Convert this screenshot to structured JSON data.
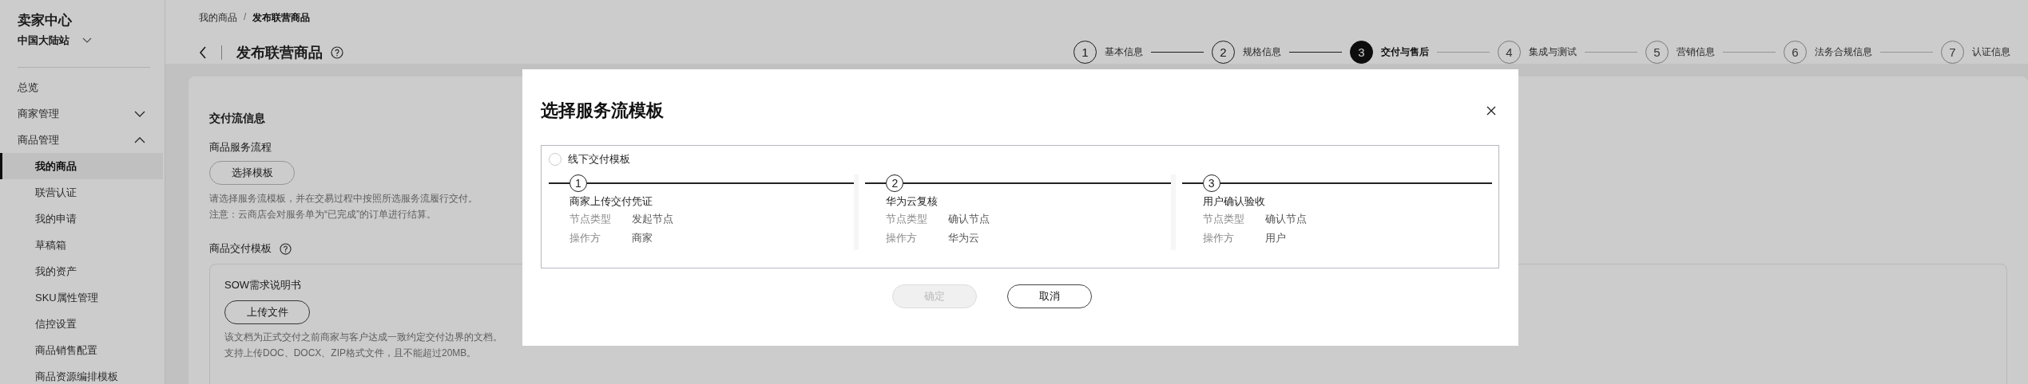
{
  "sidebar": {
    "title": "卖家中心",
    "site": "中国大陆站",
    "items": [
      {
        "label": "总览",
        "selected": false
      },
      {
        "label": "商家管理",
        "selected": false,
        "expanded": false
      },
      {
        "label": "商品管理",
        "selected": false,
        "expanded": true,
        "children": [
          {
            "label": "我的商品",
            "selected": true
          },
          {
            "label": "联营认证",
            "selected": false
          },
          {
            "label": "我的申请",
            "selected": false
          },
          {
            "label": "草稿箱",
            "selected": false
          },
          {
            "label": "我的资产",
            "selected": false
          },
          {
            "label": "SKU属性管理",
            "selected": false
          },
          {
            "label": "信控设置",
            "selected": false
          },
          {
            "label": "商品销售配置",
            "selected": false
          },
          {
            "label": "商品资源编排模板",
            "selected": false
          }
        ]
      }
    ]
  },
  "breadcrumb": [
    {
      "label": "我的商品"
    },
    {
      "label": "发布联营商品"
    }
  ],
  "breadcrumb_separator": "/",
  "page_title": "发布联营商品",
  "steps": [
    {
      "number": "1",
      "label": "基本信息",
      "completed": true,
      "selected": false
    },
    {
      "number": "2",
      "label": "规格信息",
      "completed": true,
      "selected": false
    },
    {
      "number": "3",
      "label": "交付与售后",
      "completed": false,
      "selected": true
    },
    {
      "number": "4",
      "label": "集成与测试",
      "completed": false,
      "selected": false
    },
    {
      "number": "5",
      "label": "营销信息",
      "completed": false,
      "selected": false
    },
    {
      "number": "6",
      "label": "法务合规信息",
      "completed": false,
      "selected": false
    },
    {
      "number": "7",
      "label": "认证信息",
      "completed": false,
      "selected": false
    }
  ],
  "content": {
    "section_title": "交付流信息",
    "service_flow": {
      "label": "商品服务流程",
      "button": "选择模板",
      "hint": "请选择服务流模板，并在交易过程中按照所选服务流履行交付。",
      "note": "注意：云商店会对服务单为“已完成”的订单进行结算。"
    },
    "delivery_template": {
      "label": "商品交付模板",
      "card_title": "SOW需求说明书",
      "button": "上传文件",
      "description": "该文档为正式交付之前商家与客户达成一致约定交付边界的文档。",
      "formats": "支持上传DOC、DOCX、ZIP格式文件，且不能超过20MB。"
    }
  },
  "modal": {
    "title": "选择服务流模板",
    "template": {
      "label": "线下交付模板",
      "selected": false,
      "steps": [
        {
          "number": "1",
          "title": "商家上传交付凭证",
          "fields": [
            {
              "label": "节点类型",
              "value": "发起节点"
            },
            {
              "label": "操作方",
              "value": "商家"
            }
          ]
        },
        {
          "number": "2",
          "title": "华为云复核",
          "fields": [
            {
              "label": "节点类型",
              "value": "确认节点"
            },
            {
              "label": "操作方",
              "value": "华为云"
            }
          ]
        },
        {
          "number": "3",
          "title": "用户确认验收",
          "fields": [
            {
              "label": "节点类型",
              "value": "确认节点"
            },
            {
              "label": "操作方",
              "value": "用户"
            }
          ]
        }
      ]
    },
    "buttons": [
      {
        "label": "确定",
        "disabled": true
      },
      {
        "label": "取消",
        "disabled": false
      }
    ]
  }
}
